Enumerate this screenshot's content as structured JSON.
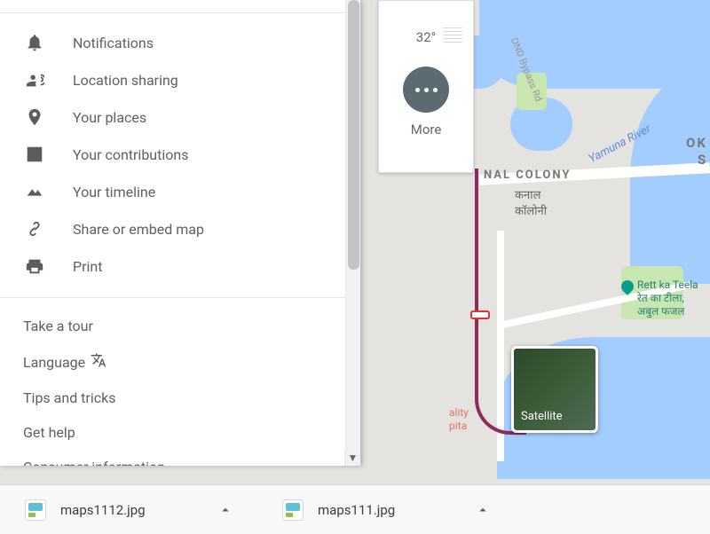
{
  "map": {
    "area_label": "NAL COLONY",
    "area_sub1": "कनाल",
    "area_sub2": "कॉलोनी",
    "river_label": "Yamuna River",
    "east_label_1": "OK",
    "east_label_2": "S",
    "bypass_label": "DND Bypass Rd",
    "poi_name": "Rett ka Teela",
    "poi_sub1": "रेत का टीला,",
    "poi_sub2": "अबुल फजल",
    "hospital_1": "ality",
    "hospital_2": "pita"
  },
  "weather": {
    "temp": "32°",
    "more_label": "More"
  },
  "satellite": {
    "label": "Satellite"
  },
  "drawer": {
    "items": [
      {
        "label": "Notifications"
      },
      {
        "label": "Location sharing"
      },
      {
        "label": "Your places"
      },
      {
        "label": "Your contributions"
      },
      {
        "label": "Your timeline"
      },
      {
        "label": "Share or embed map"
      },
      {
        "label": "Print"
      }
    ],
    "links": [
      "Take a tour",
      "Language",
      "Tips and tricks",
      "Get help",
      "Consumer information"
    ]
  },
  "downloads": {
    "items": [
      {
        "name": "maps1112.jpg"
      },
      {
        "name": "maps111.jpg"
      }
    ]
  }
}
